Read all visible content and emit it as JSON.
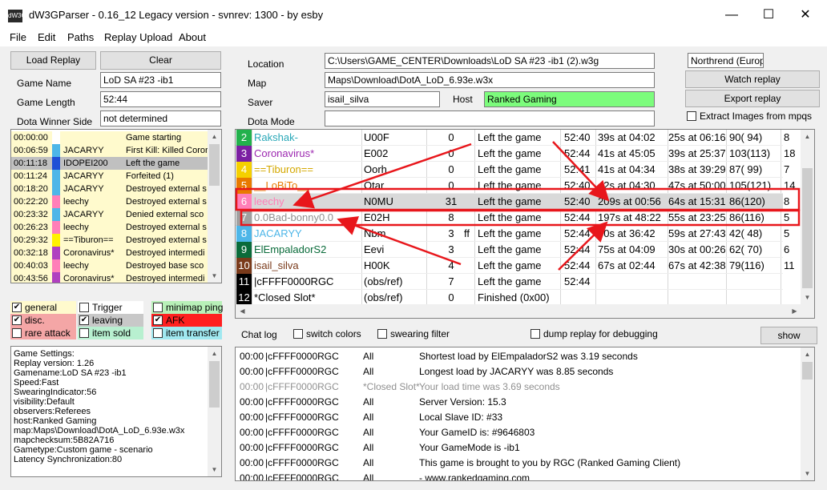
{
  "window": {
    "title": "dW3GParser - 0.16_12 Legacy version - svnrev: 1300 - by esby",
    "icon_text": "dW3G"
  },
  "menu": [
    "File",
    "Edit",
    "Paths",
    "Replay Upload",
    "About"
  ],
  "left": {
    "load_replay": "Load Replay",
    "clear": "Clear",
    "game_name_label": "Game Name",
    "game_name": "LoD SA #23 -ib1",
    "game_length_label": "Game Length",
    "game_length": "52:44",
    "winner_label": "Dota Winner Side",
    "winner": "not determined"
  },
  "top": {
    "location_label": "Location",
    "location": "C:\\Users\\GAME_CENTER\\Downloads\\LoD SA #23 -ib1 (2).w3g",
    "map_label": "Map",
    "map": "Maps\\Download\\DotA_LoD_6.93e.w3x",
    "saver_label": "Saver",
    "saver": "isail_silva",
    "host_label": "Host",
    "host": "Ranked Gaming",
    "dota_mode_label": "Dota Mode",
    "dota_mode": "",
    "region": "Northrend (Europe)",
    "watch_replay": "Watch replay",
    "export_replay": "Export replay",
    "extract_label": "Extract Images from mpqs"
  },
  "events": [
    {
      "time": "00:00:00",
      "color": "#ffffff",
      "name": "",
      "text": "Game starting",
      "bg": "#fffacd"
    },
    {
      "time": "00:06:59",
      "color": "#4db6e8",
      "name": "JACARYY",
      "text": "First Kill: Killed Coror",
      "bg": "#fffacd"
    },
    {
      "time": "00:11:18",
      "color": "#1f4fd6",
      "name": "IDOPEI200",
      "text": "Left the game",
      "bg": "#c0c0c0"
    },
    {
      "time": "00:11:24",
      "color": "#4db6e8",
      "name": "JACARYY",
      "text": "Forfeited (1)",
      "bg": "#fffacd"
    },
    {
      "time": "00:18:20",
      "color": "#4db6e8",
      "name": "JACARYY",
      "text": "Destroyed external s",
      "bg": "#fffacd"
    },
    {
      "time": "00:22:20",
      "color": "#ff7fb8",
      "name": "leechy",
      "text": "Destroyed external s",
      "bg": "#fffacd"
    },
    {
      "time": "00:23:32",
      "color": "#4db6e8",
      "name": "JACARYY",
      "text": "Denied external sco",
      "bg": "#fffacd"
    },
    {
      "time": "00:26:23",
      "color": "#ff7fb8",
      "name": "leechy",
      "text": "Destroyed external s",
      "bg": "#fffacd"
    },
    {
      "time": "00:29:32",
      "color": "#fff200",
      "name": "==Tiburon==",
      "text": "Destroyed external s",
      "bg": "#fffacd"
    },
    {
      "time": "00:32:18",
      "color": "#b040c0",
      "name": "Coronavirus*",
      "text": "Destroyed intermedi",
      "bg": "#fffacd"
    },
    {
      "time": "00:40:03",
      "color": "#ff7fb8",
      "name": "leechy",
      "text": "Destroyed base sco",
      "bg": "#fffacd"
    },
    {
      "time": "00:43:56",
      "color": "#b040c0",
      "name": "Coronavirus*",
      "text": "Destroyed intermedi",
      "bg": "#fffacd"
    }
  ],
  "filters": [
    {
      "label": "general",
      "checked": true,
      "bg": "#fffacd"
    },
    {
      "label": "Trigger",
      "checked": false,
      "bg": "#ffffff"
    },
    {
      "label": "minimap ping",
      "checked": false,
      "bg": "#b8f0b8"
    },
    {
      "label": "disc.",
      "checked": true,
      "bg": "#f4a6a6"
    },
    {
      "label": "leaving",
      "checked": true,
      "bg": "#c8c8c8"
    },
    {
      "label": "AFK",
      "checked": true,
      "bg": "#ff2020"
    },
    {
      "label": "rare attack",
      "checked": false,
      "bg": "#f4a6a6"
    },
    {
      "label": "item sold",
      "checked": false,
      "bg": "#b8f0d0"
    },
    {
      "label": "item transfer",
      "checked": false,
      "bg": "#a0e8f0"
    }
  ],
  "game_settings": [
    "Game Settings:",
    "Replay version: 1.26",
    "Gamename:LoD SA #23 -ib1",
    "Speed:Fast",
    "SwearingIndicator:56",
    "visibility:Default",
    "observers:Referees",
    "host:Ranked Gaming",
    "map:Maps\\Download\\DotA_LoD_6.93e.w3x",
    "mapchecksum:5B82A716",
    "Gametype:Custom game - scenario",
    "Latency Synchronization:80"
  ],
  "players": [
    {
      "slot": "2",
      "slot_bg": "#22b14c",
      "name": "Rakshak-",
      "name_color": "#2aa8b8",
      "hero": "U00F",
      "kills": "0",
      "flag": "",
      "status": "Left the game",
      "time": "52:40",
      "c7": "39s at 04:02",
      "c8": "25s at 06:16",
      "c9": "90( 94)",
      "c10": "8",
      "c11": "7",
      "hl": false
    },
    {
      "slot": "3",
      "slot_bg": "#7b1fa2",
      "name": "Coronavirus*",
      "name_color": "#9c27b0",
      "hero": "E002",
      "kills": "0",
      "flag": "",
      "status": "Left the game",
      "time": "52:44",
      "c7": "41s at 45:05",
      "c8": "39s at 25:37",
      "c9": "103(113)",
      "c10": "18",
      "c11": "7",
      "hl": false
    },
    {
      "slot": "4",
      "slot_bg": "#f5d000",
      "name": "==Tiburon==",
      "name_color": "#d4a800",
      "hero": "Oorh",
      "kills": "0",
      "flag": "",
      "status": "Left the game",
      "time": "52:41",
      "c7": "41s at 04:34",
      "c8": "38s at 39:29",
      "c9": "87( 99)",
      "c10": "7",
      "c11": "1",
      "hl": false
    },
    {
      "slot": "5",
      "slot_bg": "#e87a00",
      "name": "__LoBiTo__",
      "name_color": "#e87a00",
      "hero": "Otar",
      "kills": "0",
      "flag": "",
      "status": "Left the game",
      "time": "52:40",
      "c7": "42s at 04:30",
      "c8": "47s at 50:00",
      "c9": "105(121)",
      "c10": "14",
      "c11": "6",
      "hl": false
    },
    {
      "slot": "6",
      "slot_bg": "#ff7fb8",
      "name": "leechy",
      "name_color": "#ff7fb8",
      "hero": "N0MU",
      "kills": "31",
      "flag": "",
      "status": "Left the game",
      "time": "52:40",
      "c7": "209s at 00:56",
      "c8": "64s at 15:31",
      "c9": "86(120)",
      "c10": "8",
      "c11": "1",
      "hl": true
    },
    {
      "slot": "7",
      "slot_bg": "#a0a0a0",
      "name": "0.0Bad-bonny0.0",
      "name_color": "#909090",
      "hero": "E02H",
      "kills": "8",
      "flag": "",
      "status": "Left the game",
      "time": "52:44",
      "c7": "197s at 48:22",
      "c8": "55s at 23:25",
      "c9": "86(116)",
      "c10": "5",
      "c11": "1",
      "hl": false
    },
    {
      "slot": "8",
      "slot_bg": "#4db6e8",
      "name": "JACARYY",
      "name_color": "#4db6e8",
      "hero": "Nbm",
      "kills": "3",
      "flag": "ff",
      "status": "Left the game",
      "time": "52:44",
      "c7": "60s at 36:42",
      "c8": "59s at 27:43",
      "c9": "42( 48)",
      "c10": "5",
      "c11": "1",
      "hl": false
    },
    {
      "slot": "9",
      "slot_bg": "#0a6b3a",
      "name": "ElEmpaladorS2",
      "name_color": "#0a6b3a",
      "hero": "Eevi",
      "kills": "3",
      "flag": "",
      "status": "Left the game",
      "time": "52:44",
      "c7": "75s at 04:09",
      "c8": "30s at 00:26",
      "c9": "62( 70)",
      "c10": "6",
      "c11": "1",
      "hl": false
    },
    {
      "slot": "10",
      "slot_bg": "#7a3a1a",
      "name": "isail_silva",
      "name_color": "#7a3a1a",
      "hero": "H00K",
      "kills": "4",
      "flag": "",
      "status": "Left the game",
      "time": "52:44",
      "c7": "67s at 02:44",
      "c8": "67s at 42:38",
      "c9": "79(116)",
      "c10": "11",
      "c11": "1",
      "hl": false
    },
    {
      "slot": "11",
      "slot_bg": "#000000",
      "name": "|cFFFF0000RGC",
      "name_color": "#000000",
      "hero": "(obs/ref)",
      "kills": "7",
      "flag": "",
      "status": "Left the game",
      "time": "52:44",
      "c7": "",
      "c8": "",
      "c9": "",
      "c10": "",
      "c11": "",
      "hl": false
    },
    {
      "slot": "12",
      "slot_bg": "#000000",
      "name": "*Closed Slot*",
      "name_color": "#000000",
      "hero": "(obs/ref)",
      "kills": "0",
      "flag": "",
      "status": "Finished (0x00)",
      "time": "",
      "c7": "",
      "c8": "",
      "c9": "",
      "c10": "",
      "c11": "",
      "hl": false
    }
  ],
  "chatbar": {
    "chat_log": "Chat log",
    "switch_colors": "switch colors",
    "swearing_filter": "swearing filter",
    "dump_replay": "dump replay for debugging",
    "show_actions": "show actions"
  },
  "chat": [
    {
      "time": "00:00",
      "from": "|cFFFF0000RGC",
      "to": "All",
      "msg": "Shortest load by ElEmpaladorS2 was 3.19 seconds",
      "gray": false
    },
    {
      "time": "00:00",
      "from": "|cFFFF0000RGC",
      "to": "All",
      "msg": "Longest load by JACARYY was 8.85 seconds",
      "gray": false
    },
    {
      "time": "00:00",
      "from": "|cFFFF0000RGC",
      "to": "*Closed Slot*",
      "msg": "Your load time was 3.69 seconds",
      "gray": true
    },
    {
      "time": "00:00",
      "from": "|cFFFF0000RGC",
      "to": "All",
      "msg": "Server Version: 15.3",
      "gray": false
    },
    {
      "time": "00:00",
      "from": "|cFFFF0000RGC",
      "to": "All",
      "msg": "Local Slave ID: #33",
      "gray": false
    },
    {
      "time": "00:00",
      "from": "|cFFFF0000RGC",
      "to": "All",
      "msg": "Your GameID is: #9646803",
      "gray": false
    },
    {
      "time": "00:00",
      "from": "|cFFFF0000RGC",
      "to": "All",
      "msg": "Your GameMode is -ib1",
      "gray": false
    },
    {
      "time": "00:00",
      "from": "|cFFFF0000RGC",
      "to": "All",
      "msg": "This game is brought to you by RGC (Ranked Gaming Client)",
      "gray": false
    },
    {
      "time": "00:00",
      "from": "|cFFFF0000RGC",
      "to": "All",
      "msg": "- www.rankedgaming.com",
      "gray": false
    }
  ],
  "colors": {
    "annotation_red": "#e8161b",
    "host_green": "#7cfc7c"
  }
}
